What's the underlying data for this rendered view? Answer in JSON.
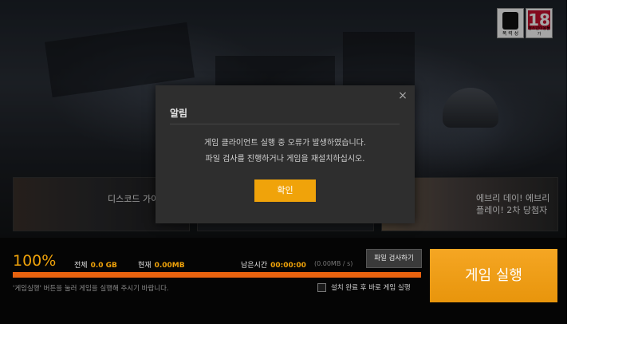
{
  "rating": {
    "violence_label": "폭 력 성",
    "age": "18",
    "age_label": "청소년이용불가"
  },
  "cards": [
    {
      "title": "디스코드 가이"
    },
    {
      "title": ""
    },
    {
      "title": "에브리 데이! 에브리\n플레이! 2차 당첨자"
    }
  ],
  "dialog": {
    "title": "알림",
    "line1": "게임 클라이언트 실행 중 오류가 발생하였습니다.",
    "line2": "파일 검사를 진행하거나 게임을 재설치하십시오.",
    "ok_label": "확인",
    "close_glyph": "×"
  },
  "status": {
    "progress_percent": "100%",
    "progress_fraction": 1.0,
    "total_label": "전체",
    "total_value": "0.0 GB",
    "current_label": "현재",
    "current_value": "0.00MB",
    "remaining_label": "남은시간",
    "remaining_value": "00:00:00",
    "speed": "(0.00MB / s)",
    "check_files_label": "파일 검사하기",
    "hint": "'게임실행' 버튼을 눌러 게임을 실행해 주시기 바랍니다.",
    "auto_launch_label": "설치 완료 후 바로 게임 실행",
    "auto_launch_checked": false,
    "launch_label": "게임 실행"
  },
  "colors": {
    "accent": "#f0a30a",
    "progress": "#e8620f",
    "age_red": "#c8102e"
  }
}
